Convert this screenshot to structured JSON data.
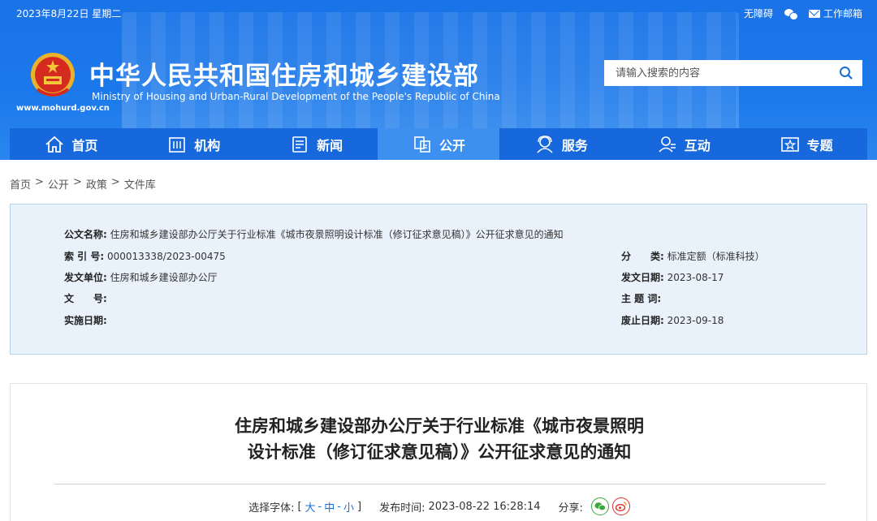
{
  "topbar": {
    "date": "2023年8月22日 星期二",
    "accessibility": "无障碍",
    "email": "工作邮箱"
  },
  "header": {
    "url": "www.mohurd.gov.cn",
    "title": "中华人民共和国住房和城乡建设部",
    "subtitle": "Ministry of Housing and Urban-Rural Development of the People's Republic of China"
  },
  "search": {
    "placeholder": "请输入搜索的内容"
  },
  "nav": {
    "items": [
      {
        "label": "首页",
        "icon": "home-icon"
      },
      {
        "label": "机构",
        "icon": "building-icon"
      },
      {
        "label": "新闻",
        "icon": "news-icon"
      },
      {
        "label": "公开",
        "icon": "public-icon"
      },
      {
        "label": "服务",
        "icon": "service-icon"
      },
      {
        "label": "互动",
        "icon": "interact-icon"
      },
      {
        "label": "专题",
        "icon": "topic-icon"
      }
    ],
    "active": "公开"
  },
  "breadcrumb": [
    "首页",
    "公开",
    "政策",
    "文件库"
  ],
  "info": {
    "doc_name_label": "公文名称:",
    "doc_name": "住房和城乡建设部办公厅关于行业标准《城市夜景照明设计标准（修订征求意见稿）》公开征求意见的通知",
    "index_label": "索 引 号:",
    "index": "000013338/2023-00475",
    "category_label": "分　　类:",
    "category": "标准定额（标准科技）",
    "issuer_label": "发文单位:",
    "issuer": "住房和城乡建设部办公厅",
    "issue_date_label": "发文日期:",
    "issue_date": "2023-08-17",
    "doc_no_label": "文　　号:",
    "doc_no": "",
    "keywords_label": "主 题 词:",
    "keywords": "",
    "effective_label": "实施日期:",
    "effective": "",
    "expire_label": "废止日期:",
    "expire": "2023-09-18"
  },
  "article": {
    "title_line1": "住房和城乡建设部办公厅关于行业标准《城市夜景照明",
    "title_line2": "设计标准（修订征求意见稿）》公开征求意见的通知",
    "font_label": "选择字体:",
    "font_open": "[",
    "font_large": "大",
    "font_medium": "中",
    "font_small": "小",
    "font_sep": "-",
    "font_close": "]",
    "publish_label": "发布时间:",
    "publish_time": "2023-08-22 16:28:14",
    "share_label": "分享:"
  },
  "colors": {
    "header_blue": "#1a73e8",
    "nav_blue": "#1668dc",
    "nav_active": "#3d8ff0",
    "info_bg": "#e9f2fb",
    "link_blue": "#1a6fd6"
  }
}
